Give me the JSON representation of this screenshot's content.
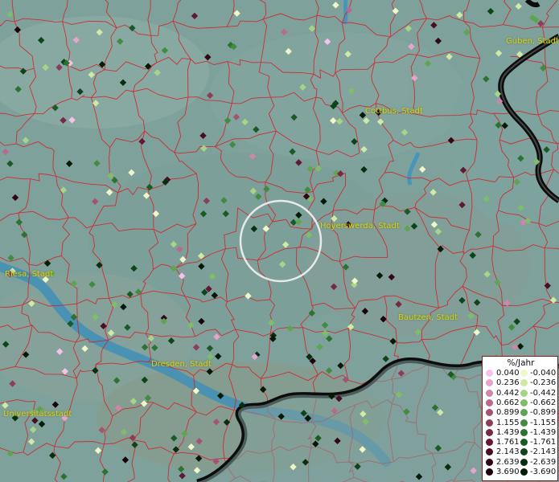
{
  "map": {
    "cities": [
      {
        "label": "Guben, Stadt"
      },
      {
        "label": "Cottbus, Stadt"
      },
      {
        "label": "Hoyerswerda, Stadt"
      },
      {
        "label": "Riesa, Stadt"
      },
      {
        "label": "Bautzen, Stadt"
      },
      {
        "label": "Dresden, Stadt"
      },
      {
        "label": "Universitätsstadt"
      }
    ]
  },
  "legend": {
    "title": "%/Jahr",
    "positive": [
      {
        "value": "0.040",
        "color": "#f6c2e9"
      },
      {
        "value": "0.236",
        "color": "#e7a3cc"
      },
      {
        "value": "0.442",
        "color": "#cf86ab"
      },
      {
        "value": "0.662",
        "color": "#b8698d"
      },
      {
        "value": "0.899",
        "color": "#a45372"
      },
      {
        "value": "1.155",
        "color": "#8e3c5c"
      },
      {
        "value": "1.439",
        "color": "#772845"
      },
      {
        "value": "1.761",
        "color": "#611834"
      },
      {
        "value": "2.143",
        "color": "#4a0d24"
      },
      {
        "value": "2.639",
        "color": "#330616"
      },
      {
        "value": "3.690",
        "color": "#1b0208"
      }
    ],
    "negative": [
      {
        "value": "-0.040",
        "color": "#eef8c9"
      },
      {
        "value": "-0.236",
        "color": "#cfeaa4"
      },
      {
        "value": "-0.442",
        "color": "#a8d585"
      },
      {
        "value": "-0.662",
        "color": "#7fbe68"
      },
      {
        "value": "-0.899",
        "color": "#5ea552"
      },
      {
        "value": "-1.155",
        "color": "#428c40"
      },
      {
        "value": "-1.439",
        "color": "#2b7331"
      },
      {
        "value": "-1.761",
        "color": "#1a5b25"
      },
      {
        "value": "-2.143",
        "color": "#0e4419"
      },
      {
        "value": "-2.639",
        "color": "#062e0f"
      },
      {
        "value": "-3.690",
        "color": "#021a06"
      }
    ]
  }
}
